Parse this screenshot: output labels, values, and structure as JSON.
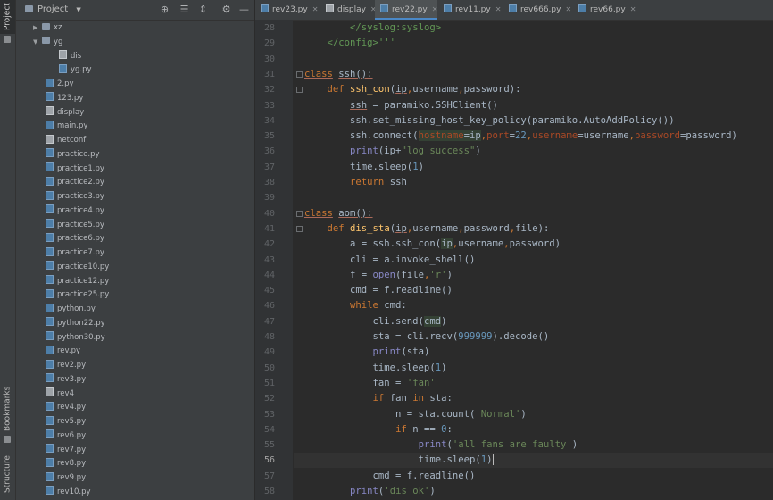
{
  "sidebar_strip": {
    "project_label": "Project",
    "bookmarks_label": "Bookmarks",
    "structure_label": "Structure"
  },
  "project_panel": {
    "title": "Project",
    "tree": [
      {
        "label": "xz",
        "type": "folder",
        "arrow": "▶"
      },
      {
        "label": "yg",
        "type": "folder",
        "arrow": "▼"
      },
      {
        "label": "dis",
        "type": "plain"
      },
      {
        "label": "yg.py",
        "type": "py"
      },
      {
        "label": "2.py",
        "type": "py"
      },
      {
        "label": "123.py",
        "type": "py"
      },
      {
        "label": "display",
        "type": "plain"
      },
      {
        "label": "main.py",
        "type": "py"
      },
      {
        "label": "netconf",
        "type": "plain"
      },
      {
        "label": "practice.py",
        "type": "py"
      },
      {
        "label": "practice1.py",
        "type": "py"
      },
      {
        "label": "practice2.py",
        "type": "py"
      },
      {
        "label": "practice3.py",
        "type": "py"
      },
      {
        "label": "practice4.py",
        "type": "py"
      },
      {
        "label": "practice5.py",
        "type": "py"
      },
      {
        "label": "practice6.py",
        "type": "py"
      },
      {
        "label": "practice7.py",
        "type": "py"
      },
      {
        "label": "practice10.py",
        "type": "py"
      },
      {
        "label": "practice12.py",
        "type": "py"
      },
      {
        "label": "practice25.py",
        "type": "py"
      },
      {
        "label": "python.py",
        "type": "py"
      },
      {
        "label": "python22.py",
        "type": "py"
      },
      {
        "label": "python30.py",
        "type": "py"
      },
      {
        "label": "rev.py",
        "type": "py"
      },
      {
        "label": "rev2.py",
        "type": "py"
      },
      {
        "label": "rev3.py",
        "type": "py"
      },
      {
        "label": "rev4",
        "type": "plain"
      },
      {
        "label": "rev4.py",
        "type": "py"
      },
      {
        "label": "rev5.py",
        "type": "py"
      },
      {
        "label": "rev6.py",
        "type": "py"
      },
      {
        "label": "rev7.py",
        "type": "py"
      },
      {
        "label": "rev8.py",
        "type": "py"
      },
      {
        "label": "rev9.py",
        "type": "py"
      },
      {
        "label": "rev10.py",
        "type": "py"
      }
    ]
  },
  "tabs": [
    {
      "label": "rev23.py",
      "type": "py",
      "active": false
    },
    {
      "label": "display",
      "type": "plain",
      "active": false
    },
    {
      "label": "rev22.py",
      "type": "py",
      "active": true
    },
    {
      "label": "rev11.py",
      "type": "py",
      "active": false
    },
    {
      "label": "rev666.py",
      "type": "py",
      "active": false
    },
    {
      "label": "rev66.py",
      "type": "py",
      "active": false
    }
  ],
  "editor": {
    "current_line": 56,
    "lines": [
      {
        "n": 28,
        "html": "        <span class=\"gray\">&lt;/syslog:syslog&gt;</span>"
      },
      {
        "n": 29,
        "html": "    <span class=\"gray\">&lt;/config&gt;'''</span>"
      },
      {
        "n": 30,
        "html": ""
      },
      {
        "n": 31,
        "html": "<span class=\"kw ul\">class</span> <span class=\"ul\">ssh():</span>"
      },
      {
        "n": 32,
        "html": "    <span class=\"kw\">def</span> <span class=\"fn\">ssh_con</span>(<span class=\"ul\">ip</span><span class=\"kw\">,</span>username<span class=\"kw\">,</span>password):"
      },
      {
        "n": 33,
        "html": "        <span class=\"ul\">ssh</span> = paramiko.SSHClient()"
      },
      {
        "n": 34,
        "html": "        ssh.set_missing_host_key_policy(paramiko.AutoAddPolicy())"
      },
      {
        "n": 35,
        "html": "        ssh.connect(<span class=\"hl\"><span class=\"nm\">hostname</span>=ip</span><span class=\"kw\">,</span><span class=\"nm\">port</span>=<span class=\"num\">22</span><span class=\"kw\">,</span><span class=\"nm\">username</span>=username<span class=\"kw\">,</span><span class=\"nm\">password</span>=password)"
      },
      {
        "n": 36,
        "html": "        <span class=\"bi\">print</span>(ip+<span class=\"str\">\"log success\"</span>)"
      },
      {
        "n": 37,
        "html": "        time.sleep(<span class=\"num\">1</span>)"
      },
      {
        "n": 38,
        "html": "        <span class=\"kw\">return</span> ssh"
      },
      {
        "n": 39,
        "html": ""
      },
      {
        "n": 40,
        "html": "<span class=\"kw ul\">class</span> <span class=\"ul\">aom():</span>"
      },
      {
        "n": 41,
        "html": "    <span class=\"kw\">def</span> <span class=\"fn\">dis_sta</span>(<span class=\"ul\">ip</span><span class=\"kw\">,</span>username<span class=\"kw\">,</span>password<span class=\"kw\">,</span>file):"
      },
      {
        "n": 42,
        "html": "        a = ssh.ssh_con(<span class=\"hl\">ip</span><span class=\"kw\">,</span>username<span class=\"kw\">,</span>password)"
      },
      {
        "n": 43,
        "html": "        cli = a.invoke_shell()"
      },
      {
        "n": 44,
        "html": "        f = <span class=\"bi\">open</span>(file<span class=\"kw\">,</span><span class=\"str\">'r'</span>)"
      },
      {
        "n": 45,
        "html": "        cmd = f.readline()"
      },
      {
        "n": 46,
        "html": "        <span class=\"kw\">while</span> cmd:"
      },
      {
        "n": 47,
        "html": "            cli.send(<span class=\"hl\">cmd</span>)"
      },
      {
        "n": 48,
        "html": "            sta = cli.recv(<span class=\"num\">999999</span>).decode()"
      },
      {
        "n": 49,
        "html": "            <span class=\"bi\">print</span>(sta)"
      },
      {
        "n": 50,
        "html": "            time.sleep(<span class=\"num\">1</span>)"
      },
      {
        "n": 51,
        "html": "            fan = <span class=\"str\">'fan'</span>"
      },
      {
        "n": 52,
        "html": "            <span class=\"kw\">if</span> fan <span class=\"kw\">in</span> sta:"
      },
      {
        "n": 53,
        "html": "                n = sta.count(<span class=\"str\">'Normal'</span>)"
      },
      {
        "n": 54,
        "html": "                <span class=\"kw\">if</span> n == <span class=\"num\">0</span>:"
      },
      {
        "n": 55,
        "html": "                    <span class=\"bi\">print</span>(<span class=\"str\">'all fans are faulty'</span>)"
      },
      {
        "n": 56,
        "html": "                    time.sleep(<span class=\"num\">1</span>)<span class=\"caret\"></span>"
      },
      {
        "n": 57,
        "html": "            cmd = f.readline()"
      },
      {
        "n": 58,
        "html": "        <span class=\"bi\">print</span>(<span class=\"str\">'dis ok'</span>)"
      }
    ]
  }
}
